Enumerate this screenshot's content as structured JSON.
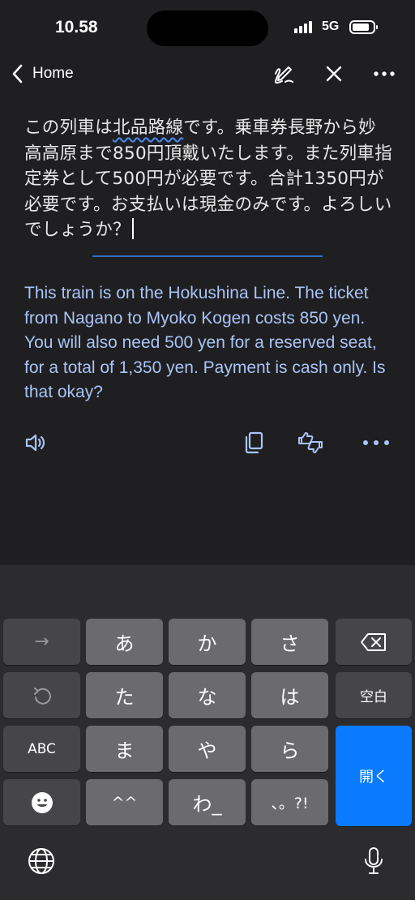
{
  "status": {
    "time": "10.58",
    "network": "5G"
  },
  "header": {
    "back_label": "Home"
  },
  "source": {
    "before_wavy": "この列車は",
    "wavy": "北品路線",
    "after_wavy": "です。乗車券長野から妙高高原まで850円頂戴いたします。また列車指定券として500円が必要です。合計1350円が必要です。お支払いは現金のみです。よろしいでしょうか？"
  },
  "translation": "This train is on the Hokushina Line. The ticket from Nagano to Myoko Kogen costs 850 yen. You will also need 500 yen for a reserved seat, for a total of 1,350 yen. Payment is cash only. Is that okay?",
  "keyboard": {
    "arrow": "→",
    "a": "あ",
    "ka": "か",
    "sa": "さ",
    "ta": "た",
    "na": "な",
    "ha": "は",
    "space": "空白",
    "abc": "ABC",
    "ma": "ま",
    "ya": "や",
    "ra": "ら",
    "enter": "開く",
    "kaomoji": "^^",
    "wa": "わ_",
    "punct": "、。?!"
  },
  "colors": {
    "accent": "#0a7aff",
    "translation_text": "#a9c4f7",
    "divider": "#2f6fc2"
  }
}
